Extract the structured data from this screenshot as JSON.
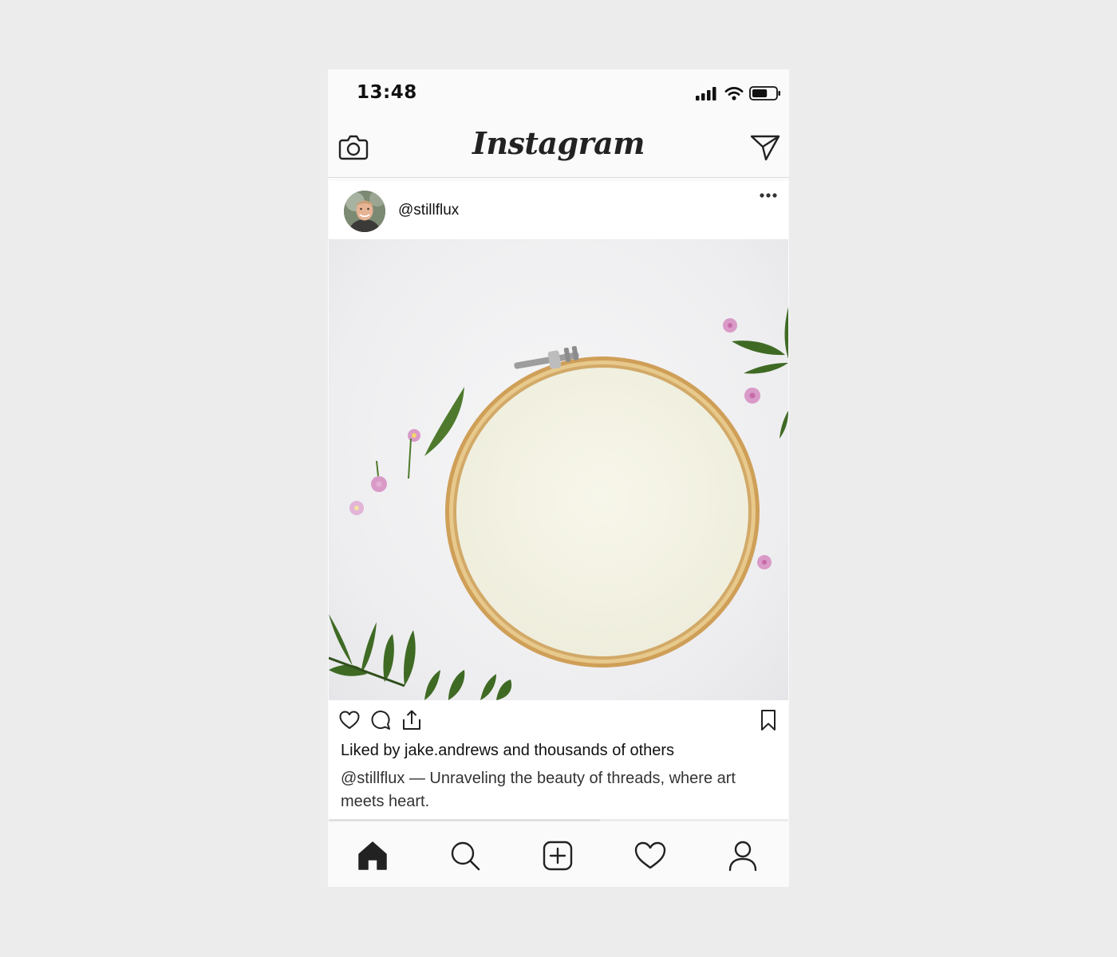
{
  "status_bar": {
    "time": "13:48",
    "icons": [
      "signal-icon",
      "wifi-icon",
      "battery-icon"
    ],
    "battery_level": 0.65
  },
  "header": {
    "logo": "Instagram",
    "left_icon": "camera-icon",
    "right_icon": "direct-message-icon"
  },
  "post": {
    "username": "@stillflux",
    "more_icon": "more-options-icon",
    "image_subject": "embroidery-hoop",
    "actions": [
      "heart-icon",
      "comment-icon",
      "share-icon"
    ],
    "save_icon": "bookmark-icon",
    "likes_text": "Liked by jake.andrews and thousands of others",
    "caption": "@stillflux — Unraveling the beauty of threads, where art meets heart.",
    "carousel_progress": 0.59
  },
  "bottom_nav": {
    "items": [
      {
        "name": "home",
        "icon": "home-icon",
        "active": true
      },
      {
        "name": "search",
        "icon": "search-icon",
        "active": false
      },
      {
        "name": "new-post",
        "icon": "add-post-icon",
        "active": false
      },
      {
        "name": "activity",
        "icon": "heart-icon",
        "active": false
      },
      {
        "name": "profile",
        "icon": "profile-icon",
        "active": false
      }
    ]
  },
  "colors": {
    "page_background": "#ececec",
    "app_background": "#fafafa",
    "icon": "#222222",
    "flower": "#d99ac8",
    "leaf": "#3f6a24",
    "hoop": "#d8b070",
    "fabric": "#f6f4e6"
  }
}
